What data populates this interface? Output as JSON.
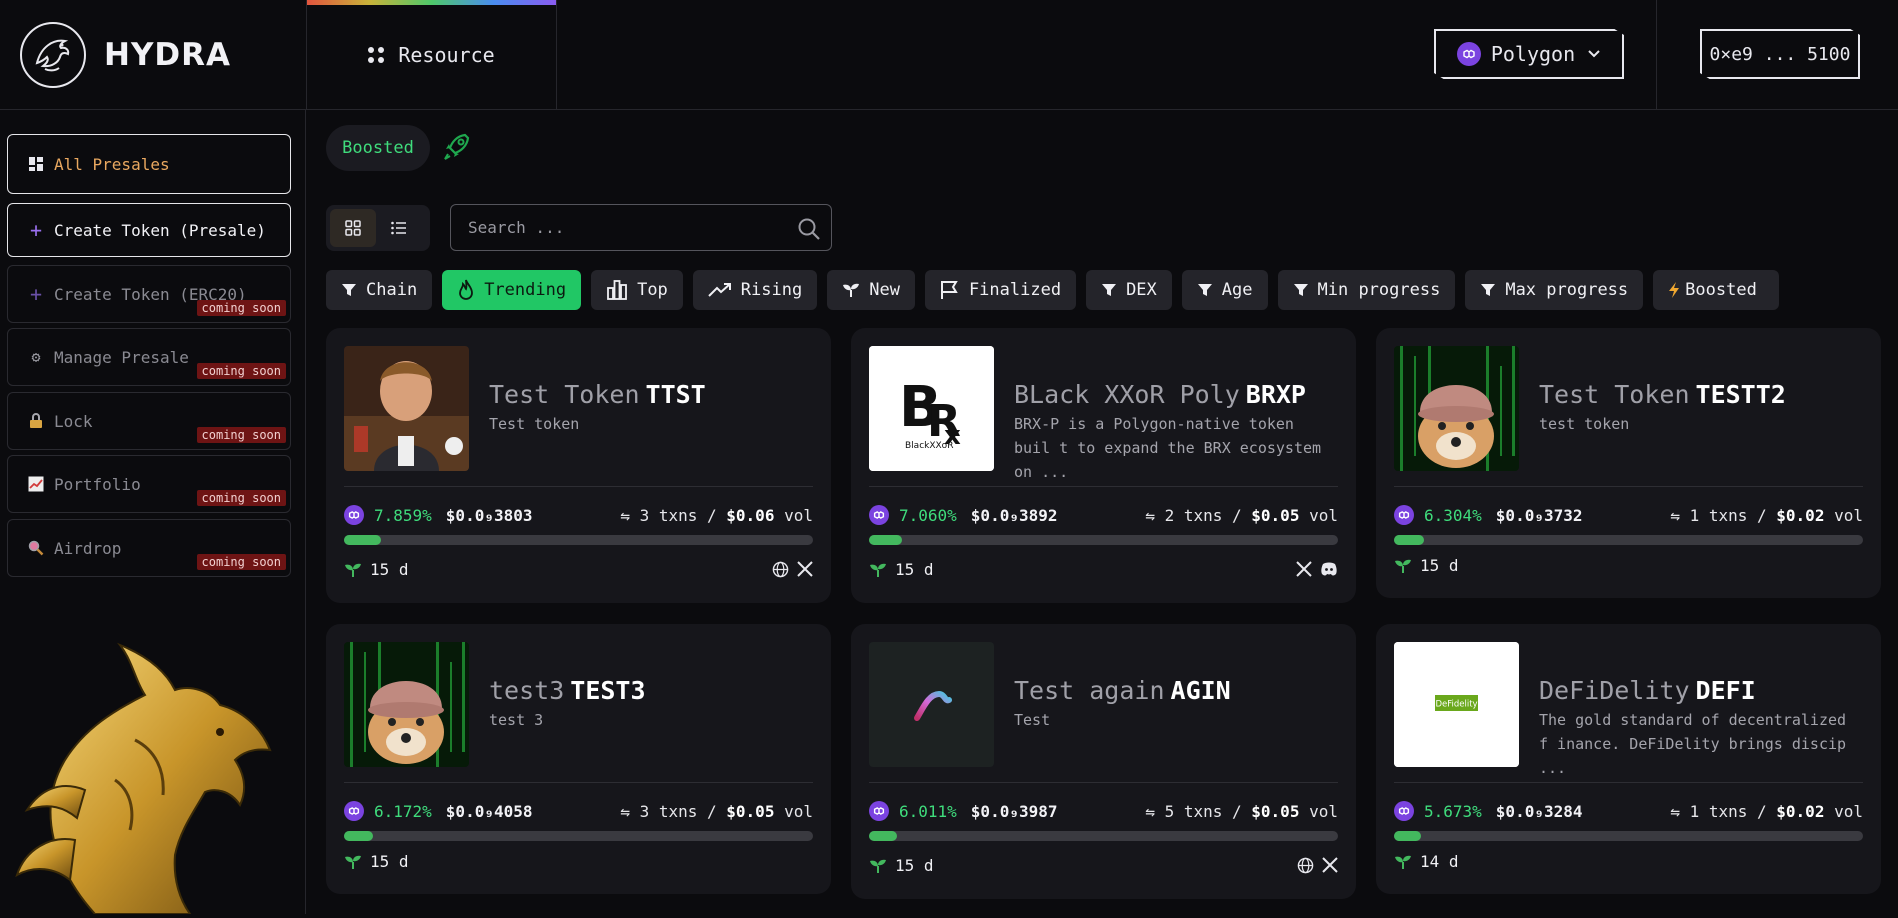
{
  "header": {
    "brand": "HYDRA",
    "resource_label": "Resource",
    "chain_label": "Polygon",
    "wallet_label": "0×e9 ... 5100"
  },
  "sidebar": {
    "items": [
      {
        "label": "All Presales",
        "icon": "grid-icon"
      },
      {
        "label": "Create Token (Presale)",
        "icon": "plus-icon"
      },
      {
        "label": "Create Token (ERC20)",
        "icon": "plus-icon",
        "badge": "coming soon"
      },
      {
        "label": "Manage Presale",
        "icon": "gear-icon",
        "badge": "coming soon"
      },
      {
        "label": "Lock",
        "icon": "lock-icon",
        "badge": "coming soon"
      },
      {
        "label": "Portfolio",
        "icon": "chart-icon",
        "badge": "coming soon"
      },
      {
        "label": "Airdrop",
        "icon": "magnifier-icon",
        "badge": "coming soon"
      }
    ]
  },
  "main": {
    "boosted_label": "Boosted",
    "search_placeholder": "Search ...",
    "filters": [
      {
        "label": "Chain",
        "icon": "funnel-icon"
      },
      {
        "label": "Trending",
        "icon": "flame-icon",
        "active": true
      },
      {
        "label": "Top",
        "icon": "bar-chart-icon"
      },
      {
        "label": "Rising",
        "icon": "trend-up-icon"
      },
      {
        "label": "New",
        "icon": "sprout-icon"
      },
      {
        "label": "Finalized",
        "icon": "flag-icon"
      },
      {
        "label": "DEX",
        "icon": "funnel-icon"
      },
      {
        "label": "Age",
        "icon": "funnel-icon"
      },
      {
        "label": "Min progress",
        "icon": "funnel-icon"
      },
      {
        "label": "Max progress",
        "icon": "funnel-icon"
      },
      {
        "label": "Boosted",
        "icon": "bolt-icon"
      }
    ],
    "cards": [
      {
        "name": "Test Token",
        "symbol": "TTST",
        "desc": "Test token",
        "pct": "7.859%",
        "price": "$0.0₉3803",
        "txns": "3 txns /",
        "vol": "$0.06",
        "vol_unit": "vol",
        "progress": 0.078,
        "age": "15 d",
        "socials": [
          "globe-icon",
          "x-icon"
        ]
      },
      {
        "name": "BLack XXoR Poly",
        "symbol": "BRXP",
        "desc": "BRX-P is a Polygon-native token buil t to expand the BRX ecosystem on ...",
        "pct": "7.060%",
        "price": "$0.0₉3892",
        "txns": "2 txns /",
        "vol": "$0.05",
        "vol_unit": "vol",
        "progress": 0.07,
        "age": "15 d",
        "socials": [
          "x-icon",
          "discord-icon"
        ]
      },
      {
        "name": "Test Token",
        "symbol": "TESTT2",
        "desc": "test token",
        "pct": "6.304%",
        "price": "$0.0₉3732",
        "txns": "1 txns /",
        "vol": "$0.02",
        "vol_unit": "vol",
        "progress": 0.063,
        "age": "15 d",
        "socials": []
      },
      {
        "name": "test3",
        "symbol": "TEST3",
        "desc": "test 3",
        "pct": "6.172%",
        "price": "$0.0₉4058",
        "txns": "3 txns /",
        "vol": "$0.05",
        "vol_unit": "vol",
        "progress": 0.062,
        "age": "15 d",
        "socials": []
      },
      {
        "name": "Test again",
        "symbol": "AGIN",
        "desc": "Test",
        "pct": "6.011%",
        "price": "$0.0₉3987",
        "txns": "5 txns /",
        "vol": "$0.05",
        "vol_unit": "vol",
        "progress": 0.06,
        "age": "15 d",
        "socials": [
          "globe-icon",
          "x-icon"
        ]
      },
      {
        "name": "DeFiDelity",
        "symbol": "DEFI",
        "desc": "The gold standard of decentralized f inance. DeFiDelity brings discip ...",
        "pct": "5.673%",
        "price": "$0.0₉3284",
        "txns": "1 txns /",
        "vol": "$0.02",
        "vol_unit": "vol",
        "progress": 0.057,
        "age": "14 d",
        "socials": []
      }
    ],
    "card_logo_texts": {
      "brxp": "BlackXXoR",
      "defi": "DeFidelity"
    }
  },
  "colors": {
    "accent_green": "#21c765",
    "polygon_purple": "#7b43e0",
    "soon_badge": "#6e1414",
    "active_orange": "#e9a860"
  }
}
